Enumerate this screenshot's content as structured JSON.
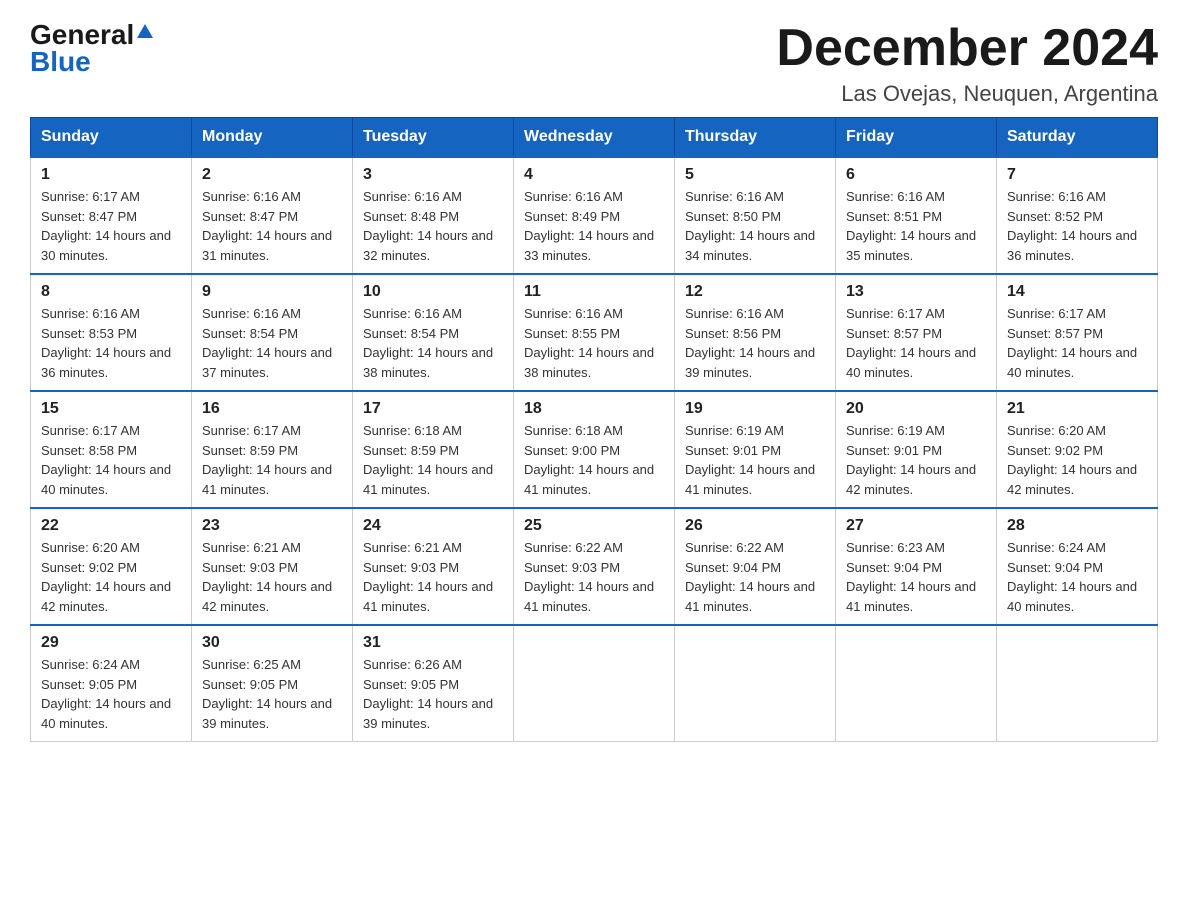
{
  "header": {
    "logo_general": "General",
    "logo_blue": "Blue",
    "month_title": "December 2024",
    "location": "Las Ovejas, Neuquen, Argentina"
  },
  "weekdays": [
    "Sunday",
    "Monday",
    "Tuesday",
    "Wednesday",
    "Thursday",
    "Friday",
    "Saturday"
  ],
  "weeks": [
    [
      {
        "day": "1",
        "sunrise": "6:17 AM",
        "sunset": "8:47 PM",
        "daylight": "14 hours and 30 minutes."
      },
      {
        "day": "2",
        "sunrise": "6:16 AM",
        "sunset": "8:47 PM",
        "daylight": "14 hours and 31 minutes."
      },
      {
        "day": "3",
        "sunrise": "6:16 AM",
        "sunset": "8:48 PM",
        "daylight": "14 hours and 32 minutes."
      },
      {
        "day": "4",
        "sunrise": "6:16 AM",
        "sunset": "8:49 PM",
        "daylight": "14 hours and 33 minutes."
      },
      {
        "day": "5",
        "sunrise": "6:16 AM",
        "sunset": "8:50 PM",
        "daylight": "14 hours and 34 minutes."
      },
      {
        "day": "6",
        "sunrise": "6:16 AM",
        "sunset": "8:51 PM",
        "daylight": "14 hours and 35 minutes."
      },
      {
        "day": "7",
        "sunrise": "6:16 AM",
        "sunset": "8:52 PM",
        "daylight": "14 hours and 36 minutes."
      }
    ],
    [
      {
        "day": "8",
        "sunrise": "6:16 AM",
        "sunset": "8:53 PM",
        "daylight": "14 hours and 36 minutes."
      },
      {
        "day": "9",
        "sunrise": "6:16 AM",
        "sunset": "8:54 PM",
        "daylight": "14 hours and 37 minutes."
      },
      {
        "day": "10",
        "sunrise": "6:16 AM",
        "sunset": "8:54 PM",
        "daylight": "14 hours and 38 minutes."
      },
      {
        "day": "11",
        "sunrise": "6:16 AM",
        "sunset": "8:55 PM",
        "daylight": "14 hours and 38 minutes."
      },
      {
        "day": "12",
        "sunrise": "6:16 AM",
        "sunset": "8:56 PM",
        "daylight": "14 hours and 39 minutes."
      },
      {
        "day": "13",
        "sunrise": "6:17 AM",
        "sunset": "8:57 PM",
        "daylight": "14 hours and 40 minutes."
      },
      {
        "day": "14",
        "sunrise": "6:17 AM",
        "sunset": "8:57 PM",
        "daylight": "14 hours and 40 minutes."
      }
    ],
    [
      {
        "day": "15",
        "sunrise": "6:17 AM",
        "sunset": "8:58 PM",
        "daylight": "14 hours and 40 minutes."
      },
      {
        "day": "16",
        "sunrise": "6:17 AM",
        "sunset": "8:59 PM",
        "daylight": "14 hours and 41 minutes."
      },
      {
        "day": "17",
        "sunrise": "6:18 AM",
        "sunset": "8:59 PM",
        "daylight": "14 hours and 41 minutes."
      },
      {
        "day": "18",
        "sunrise": "6:18 AM",
        "sunset": "9:00 PM",
        "daylight": "14 hours and 41 minutes."
      },
      {
        "day": "19",
        "sunrise": "6:19 AM",
        "sunset": "9:01 PM",
        "daylight": "14 hours and 41 minutes."
      },
      {
        "day": "20",
        "sunrise": "6:19 AM",
        "sunset": "9:01 PM",
        "daylight": "14 hours and 42 minutes."
      },
      {
        "day": "21",
        "sunrise": "6:20 AM",
        "sunset": "9:02 PM",
        "daylight": "14 hours and 42 minutes."
      }
    ],
    [
      {
        "day": "22",
        "sunrise": "6:20 AM",
        "sunset": "9:02 PM",
        "daylight": "14 hours and 42 minutes."
      },
      {
        "day": "23",
        "sunrise": "6:21 AM",
        "sunset": "9:03 PM",
        "daylight": "14 hours and 42 minutes."
      },
      {
        "day": "24",
        "sunrise": "6:21 AM",
        "sunset": "9:03 PM",
        "daylight": "14 hours and 41 minutes."
      },
      {
        "day": "25",
        "sunrise": "6:22 AM",
        "sunset": "9:03 PM",
        "daylight": "14 hours and 41 minutes."
      },
      {
        "day": "26",
        "sunrise": "6:22 AM",
        "sunset": "9:04 PM",
        "daylight": "14 hours and 41 minutes."
      },
      {
        "day": "27",
        "sunrise": "6:23 AM",
        "sunset": "9:04 PM",
        "daylight": "14 hours and 41 minutes."
      },
      {
        "day": "28",
        "sunrise": "6:24 AM",
        "sunset": "9:04 PM",
        "daylight": "14 hours and 40 minutes."
      }
    ],
    [
      {
        "day": "29",
        "sunrise": "6:24 AM",
        "sunset": "9:05 PM",
        "daylight": "14 hours and 40 minutes."
      },
      {
        "day": "30",
        "sunrise": "6:25 AM",
        "sunset": "9:05 PM",
        "daylight": "14 hours and 39 minutes."
      },
      {
        "day": "31",
        "sunrise": "6:26 AM",
        "sunset": "9:05 PM",
        "daylight": "14 hours and 39 minutes."
      },
      null,
      null,
      null,
      null
    ]
  ]
}
